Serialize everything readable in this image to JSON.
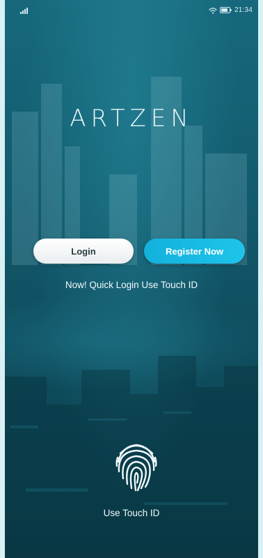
{
  "app": {
    "logo_text": "ARTZEN"
  },
  "status_bar": {
    "time": "21:34",
    "icons": [
      "signal-icon",
      "wifi-icon",
      "battery-icon"
    ]
  },
  "actions": {
    "login_label": "Login",
    "register_label": "Register Now",
    "quick_login_text": "Now! Quick Login Use Touch ID"
  },
  "touch_id": {
    "icon": "fingerprint-icon",
    "label": "Use Touch ID"
  },
  "colors": {
    "background_top": "#17687c",
    "background_bottom": "#0b3f4d",
    "register_button": "#1ec4ea",
    "login_button": "#ffffff",
    "text": "#f1fafc"
  }
}
